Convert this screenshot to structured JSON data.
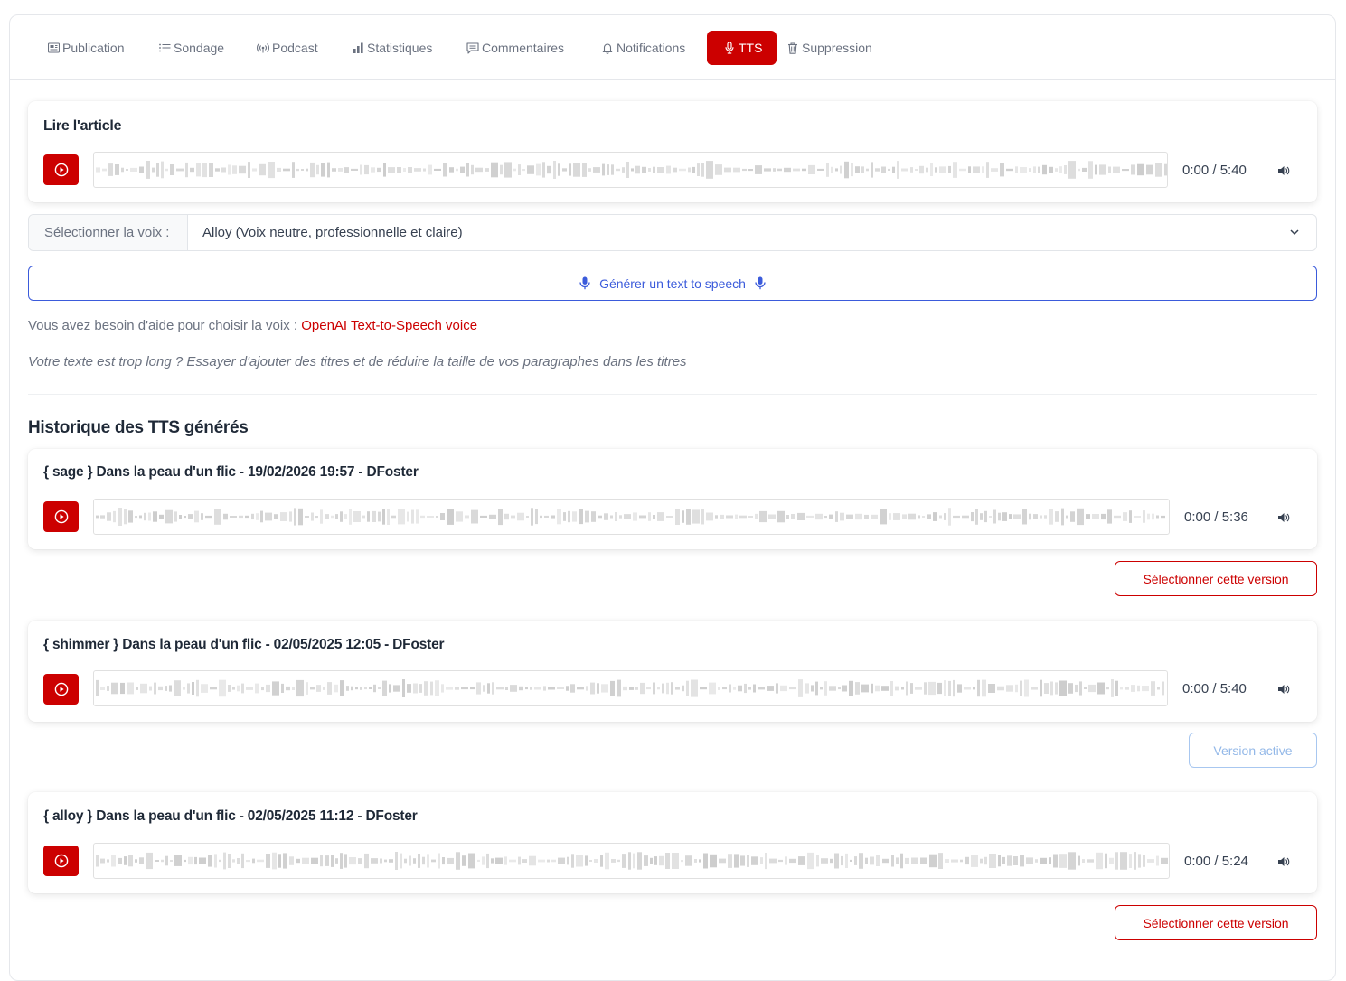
{
  "tabs": [
    {
      "label": "Publication",
      "icon": "newspaper-icon",
      "active": false
    },
    {
      "label": "Sondage",
      "icon": "list-icon",
      "active": false
    },
    {
      "label": "Podcast",
      "icon": "broadcast-icon",
      "active": false
    },
    {
      "label": "Statistiques",
      "icon": "bar-chart-icon",
      "active": false
    },
    {
      "label": "Commentaires",
      "icon": "comment-icon",
      "active": false
    },
    {
      "label": "Notifications",
      "icon": "bell-icon",
      "active": false
    },
    {
      "label": "TTS",
      "icon": "microphone-icon",
      "active": true
    },
    {
      "label": "Suppression",
      "icon": "trash-icon",
      "active": false
    }
  ],
  "reader": {
    "title": "Lire l'article",
    "time": "0:00 / 5:40"
  },
  "voice": {
    "label": "Sélectionner la voix :",
    "value": "Alloy (Voix neutre, professionnelle et claire)"
  },
  "generate": {
    "label": "Générer un text to speech"
  },
  "help": {
    "text": "Vous avez besoin d'aide pour choisir la voix : ",
    "link": "OpenAI Text-to-Speech voice"
  },
  "hint": "Votre texte est trop long ? Essayer d'ajouter des titres et de réduire la taille de vos paragraphes dans les titres",
  "history": {
    "title": "Historique des TTS générés",
    "items": [
      {
        "title": "{ sage } Dans la peau d'un flic - 19/02/2026 19:57 - DFoster",
        "time": "0:00 / 5:36",
        "button": "Sélectionner cette version",
        "is_active": false
      },
      {
        "title": "{ shimmer } Dans la peau d'un flic - 02/05/2025 12:05 - DFoster",
        "time": "0:00 / 5:40",
        "button": "Version active",
        "is_active": true
      },
      {
        "title": "{ alloy } Dans la peau d'un flic - 02/05/2025 11:12 - DFoster",
        "time": "0:00 / 5:24",
        "button": "Sélectionner cette version",
        "is_active": false
      }
    ]
  },
  "colors": {
    "accent": "#cc0000",
    "primary": "#3b5bdb",
    "active_version": "#93b8e8"
  }
}
